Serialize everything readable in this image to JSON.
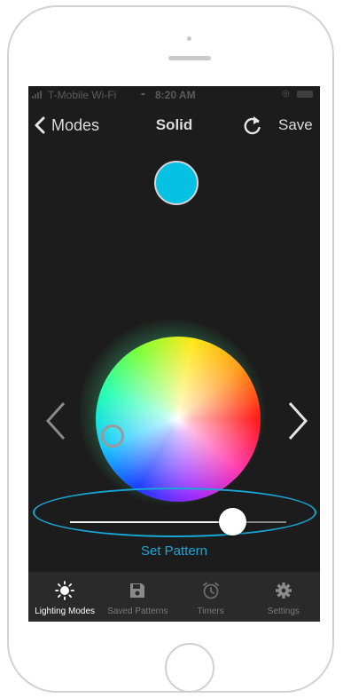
{
  "status_bar": {
    "carrier": "T-Mobile Wi-Fi",
    "time": "8:20 AM"
  },
  "nav": {
    "back_label": "Modes",
    "title": "Solid",
    "save_label": "Save"
  },
  "selected_color": "#06c1e3",
  "accent_color": "#18a6d6",
  "brightness_fraction": 0.75,
  "set_pattern_label": "Set Pattern",
  "tabs": [
    {
      "label": "Lighting Modes",
      "icon": "sun-icon",
      "active": true
    },
    {
      "label": "Saved Patterns",
      "icon": "floppy-disk-icon",
      "active": false
    },
    {
      "label": "Timers",
      "icon": "alarm-clock-icon",
      "active": false
    },
    {
      "label": "Settings",
      "icon": "gear-icon",
      "active": false
    }
  ]
}
